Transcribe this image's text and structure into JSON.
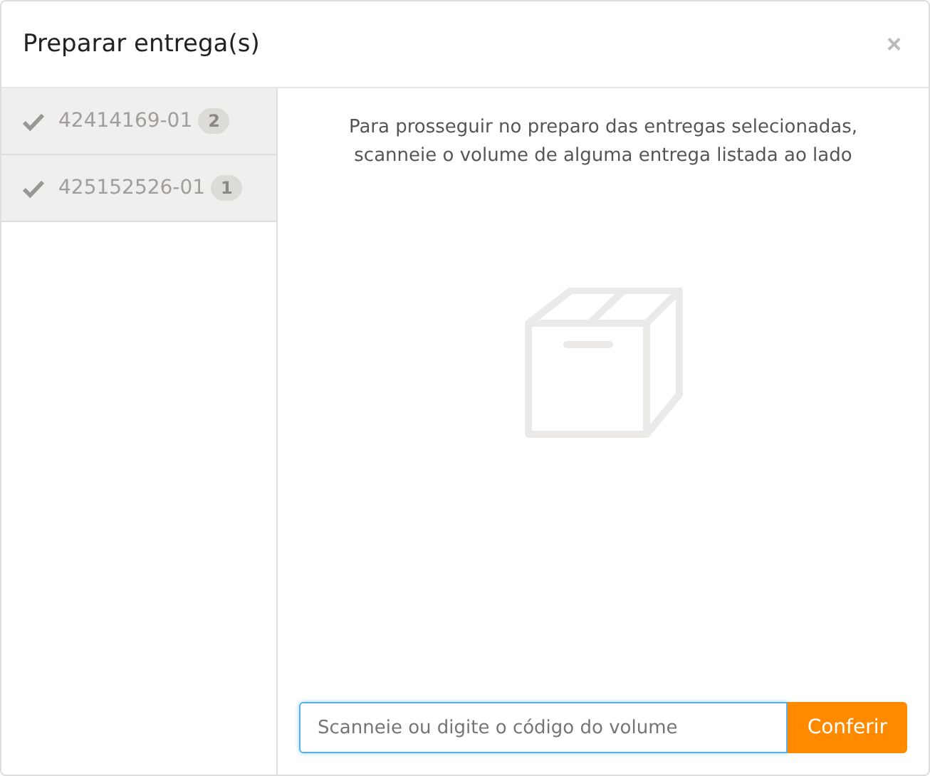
{
  "dialog": {
    "title": "Preparar entrega(s)",
    "close": "×"
  },
  "deliveries": [
    {
      "code": "42414169-01",
      "count": "2",
      "done": true
    },
    {
      "code": "425152526-01",
      "count": "1",
      "done": true
    }
  ],
  "message": "Para prosseguir no preparo das entregas selecionadas, scanneie o volume de alguma entrega listada ao lado",
  "scan": {
    "placeholder": "Scanneie ou digite o código do volume",
    "focused": true,
    "button": "Conferir"
  }
}
